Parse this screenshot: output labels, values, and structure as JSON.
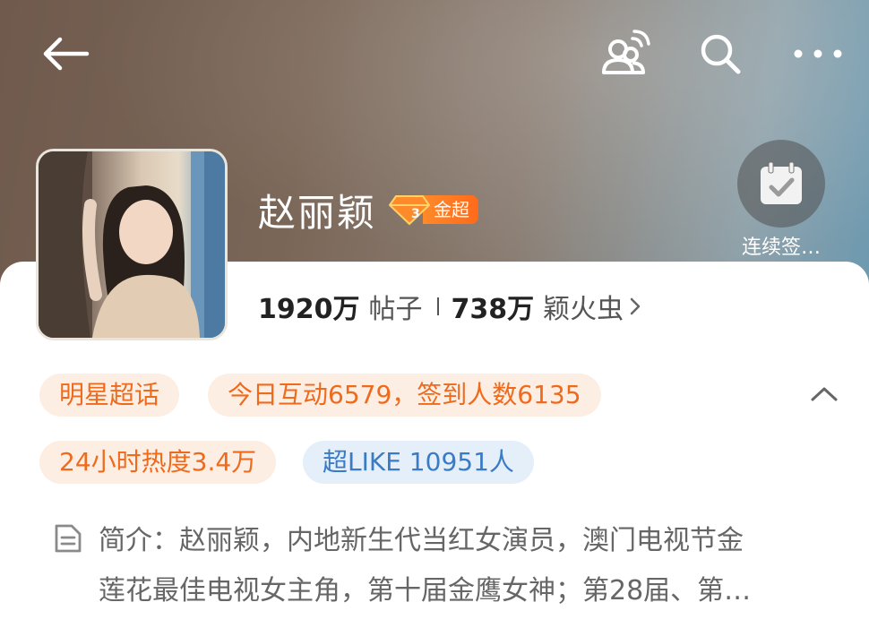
{
  "header": {
    "back_icon": "back-arrow-icon",
    "fans_icon": "fans-group-icon",
    "search_icon": "search-icon",
    "more_icon": "more-dots-icon"
  },
  "topic": {
    "name": "赵丽颖",
    "rank_badge": "金超",
    "rank_level": "3"
  },
  "signin": {
    "label": "连续签…"
  },
  "stats": {
    "posts_value": "1920万",
    "posts_label": "帖子",
    "fans_value": "738万",
    "fans_label": "颖火虫",
    "fans_arrow": "›"
  },
  "tags": {
    "category": "明星超话",
    "today": "今日互动6579，签到人数6135",
    "heat": "24小时热度3.4万",
    "superlike": "超LIKE 10951人"
  },
  "intro": {
    "line1": "简介：赵丽颖，内地新生代当红女演员，澳门电视节金",
    "line2": "莲花最佳电视女主角，第十届金鹰女神；第28届、第…"
  },
  "colors": {
    "accent_orange": "#ee6a1c",
    "accent_blue": "#3a7bc6",
    "tag_orange_bg": "#fdeee4",
    "tag_blue_bg": "#e4effa"
  }
}
